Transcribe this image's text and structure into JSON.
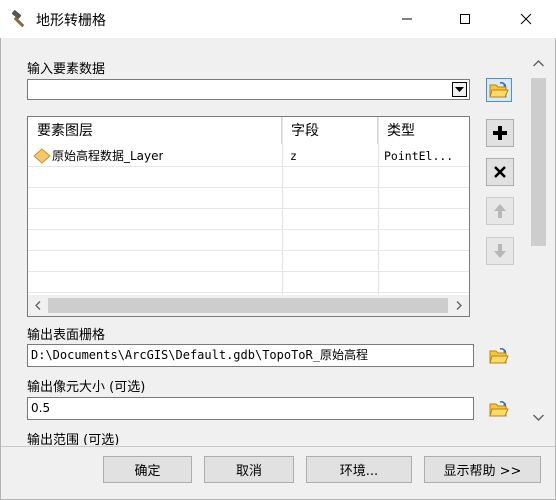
{
  "window": {
    "title": "地形转栅格",
    "app_icon": "hammer-icon"
  },
  "input_features": {
    "label": "输入要素数据",
    "value": ""
  },
  "feature_table": {
    "columns": [
      "要素图层",
      "字段",
      "类型"
    ],
    "rows": [
      {
        "layer": "原始高程数据_Layer",
        "field": "z",
        "type": "PointEl...",
        "icon": "point-layer-diamond-icon"
      }
    ]
  },
  "side_buttons": [
    "add-icon",
    "remove-icon",
    "move-up-icon",
    "move-down-icon"
  ],
  "output_surface": {
    "label": "输出表面栅格",
    "value": "D:\\Documents\\ArcGIS\\Default.gdb\\TopoToR_原始高程"
  },
  "cell_size": {
    "label": "输出像元大小 (可选)",
    "value": "0.5"
  },
  "extent": {
    "label": "输出范围 (可选)"
  },
  "buttons": {
    "ok": "确定",
    "cancel": "取消",
    "environments": "环境...",
    "show_help": "显示帮助 >>"
  },
  "colors": {
    "folder_yellow": "#f5c542",
    "diamond_fill": "#f4c86a",
    "accent_blue": "#4a90d9"
  }
}
